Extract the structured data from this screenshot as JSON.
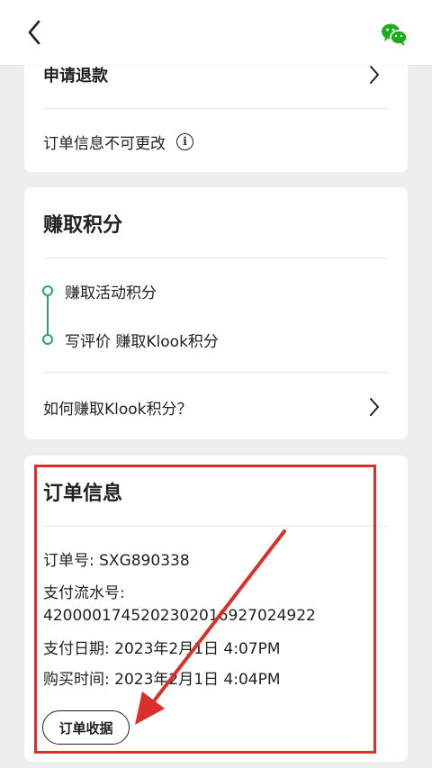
{
  "header": {
    "back_icon": "chevron-left-icon",
    "share_icon": "wechat-icon"
  },
  "refund_card": {
    "refund_label": "申请退款",
    "notice_label": "订单信息不可更改",
    "notice_icon": "info-icon"
  },
  "points_card": {
    "title": "赚取积分",
    "steps": [
      "赚取活动积分",
      "写评价 赚取Klook积分"
    ],
    "howto_label": "如何赚取Klook积分？"
  },
  "order_card": {
    "title": "订单信息",
    "order_no": "订单号: SXG890338",
    "payment_serial_label": "支付流水号:",
    "payment_serial_value": "4200001745202302016927024922",
    "pay_date": "支付日期: 2023年2月1日 4:07PM",
    "purchase_time": "购买时间: 2023年2月1日 4:04PM",
    "receipt_button": "订单收据"
  },
  "colors": {
    "accent_green": "#2a9d8f",
    "highlight_red": "#d9302c",
    "wechat_green": "#1aad19"
  }
}
